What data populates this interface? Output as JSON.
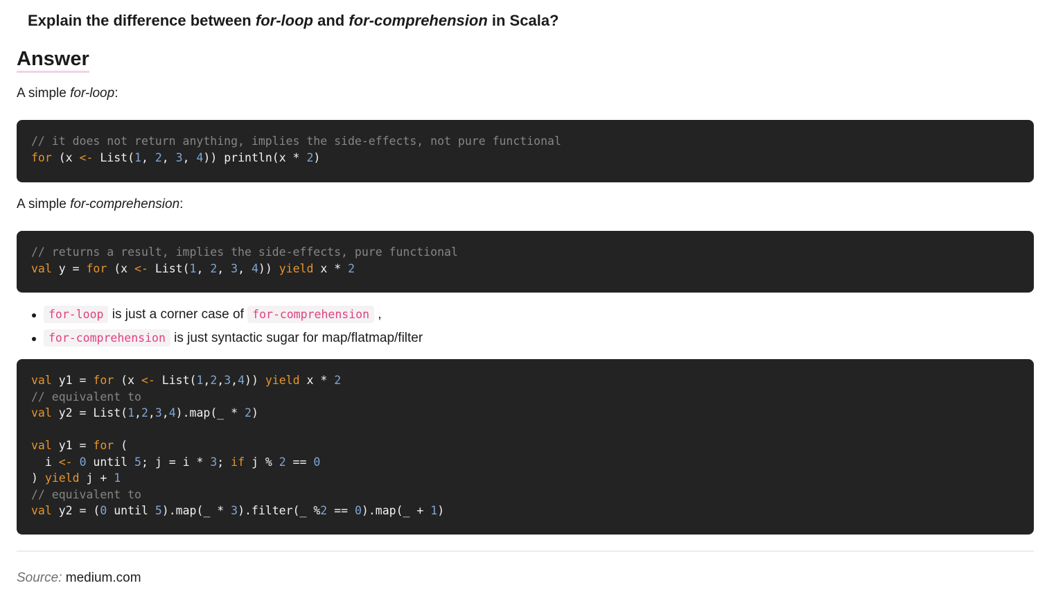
{
  "question": {
    "prefix": "Explain the difference between ",
    "term1": "for-loop",
    "middle": " and ",
    "term2": "for-comprehension",
    "suffix": " in Scala?"
  },
  "answer_heading": "Answer",
  "section1": {
    "prefix": "A simple ",
    "term": "for-loop",
    "suffix": ":"
  },
  "code1": [
    [
      {
        "t": "// it does not return anything, implies the side-effects, not pure functional",
        "c": "cmt"
      }
    ],
    [
      {
        "t": "for",
        "c": "kw"
      },
      {
        "t": " (x "
      },
      {
        "t": "<-",
        "c": "kw"
      },
      {
        "t": " List("
      },
      {
        "t": "1",
        "c": "num"
      },
      {
        "t": ", "
      },
      {
        "t": "2",
        "c": "num"
      },
      {
        "t": ", "
      },
      {
        "t": "3",
        "c": "num"
      },
      {
        "t": ", "
      },
      {
        "t": "4",
        "c": "num"
      },
      {
        "t": ")) println(x * "
      },
      {
        "t": "2",
        "c": "num"
      },
      {
        "t": ")"
      }
    ]
  ],
  "section2": {
    "prefix": "A simple ",
    "term": "for-comprehension",
    "suffix": ":"
  },
  "code2": [
    [
      {
        "t": "// returns a result, implies the side-effects, pure functional",
        "c": "cmt"
      }
    ],
    [
      {
        "t": "val",
        "c": "kw"
      },
      {
        "t": " y = "
      },
      {
        "t": "for",
        "c": "kw"
      },
      {
        "t": " (x "
      },
      {
        "t": "<-",
        "c": "kw"
      },
      {
        "t": " List("
      },
      {
        "t": "1",
        "c": "num"
      },
      {
        "t": ", "
      },
      {
        "t": "2",
        "c": "num"
      },
      {
        "t": ", "
      },
      {
        "t": "3",
        "c": "num"
      },
      {
        "t": ", "
      },
      {
        "t": "4",
        "c": "num"
      },
      {
        "t": ")) "
      },
      {
        "t": "yield",
        "c": "kw"
      },
      {
        "t": " x * "
      },
      {
        "t": "2",
        "c": "num"
      }
    ]
  ],
  "bullets": [
    {
      "code1": "for-loop",
      "text1": " is just a corner case of ",
      "code2": "for-comprehension",
      "text2": " ,"
    },
    {
      "code1": "for-comprehension",
      "text1": " is just syntactic sugar for map/flatmap/filter",
      "code2": "",
      "text2": ""
    }
  ],
  "code3": [
    [
      {
        "t": "val",
        "c": "kw"
      },
      {
        "t": " y1 = "
      },
      {
        "t": "for",
        "c": "kw"
      },
      {
        "t": " (x "
      },
      {
        "t": "<-",
        "c": "kw"
      },
      {
        "t": " List("
      },
      {
        "t": "1",
        "c": "num"
      },
      {
        "t": ","
      },
      {
        "t": "2",
        "c": "num"
      },
      {
        "t": ","
      },
      {
        "t": "3",
        "c": "num"
      },
      {
        "t": ","
      },
      {
        "t": "4",
        "c": "num"
      },
      {
        "t": ")) "
      },
      {
        "t": "yield",
        "c": "kw"
      },
      {
        "t": " x * "
      },
      {
        "t": "2",
        "c": "num"
      }
    ],
    [
      {
        "t": "// equivalent to",
        "c": "cmt"
      }
    ],
    [
      {
        "t": "val",
        "c": "kw"
      },
      {
        "t": " y2 = List("
      },
      {
        "t": "1",
        "c": "num"
      },
      {
        "t": ","
      },
      {
        "t": "2",
        "c": "num"
      },
      {
        "t": ","
      },
      {
        "t": "3",
        "c": "num"
      },
      {
        "t": ","
      },
      {
        "t": "4",
        "c": "num"
      },
      {
        "t": ").map(_ * "
      },
      {
        "t": "2",
        "c": "num"
      },
      {
        "t": ")"
      }
    ],
    [],
    [
      {
        "t": "val",
        "c": "kw"
      },
      {
        "t": " y1 = "
      },
      {
        "t": "for",
        "c": "kw"
      },
      {
        "t": " ("
      }
    ],
    [
      {
        "t": "  i "
      },
      {
        "t": "<-",
        "c": "kw"
      },
      {
        "t": " "
      },
      {
        "t": "0",
        "c": "num"
      },
      {
        "t": " until "
      },
      {
        "t": "5",
        "c": "num"
      },
      {
        "t": "; j = i * "
      },
      {
        "t": "3",
        "c": "num"
      },
      {
        "t": "; "
      },
      {
        "t": "if",
        "c": "kw"
      },
      {
        "t": " j % "
      },
      {
        "t": "2",
        "c": "num"
      },
      {
        "t": " == "
      },
      {
        "t": "0",
        "c": "num"
      }
    ],
    [
      {
        "t": ") "
      },
      {
        "t": "yield",
        "c": "kw"
      },
      {
        "t": " j + "
      },
      {
        "t": "1",
        "c": "num"
      }
    ],
    [
      {
        "t": "// equivalent to",
        "c": "cmt"
      }
    ],
    [
      {
        "t": "val",
        "c": "kw"
      },
      {
        "t": " y2 = ("
      },
      {
        "t": "0",
        "c": "num"
      },
      {
        "t": " until "
      },
      {
        "t": "5",
        "c": "num"
      },
      {
        "t": ").map(_ * "
      },
      {
        "t": "3",
        "c": "num"
      },
      {
        "t": ").filter(_ %"
      },
      {
        "t": "2",
        "c": "num"
      },
      {
        "t": " == "
      },
      {
        "t": "0",
        "c": "num"
      },
      {
        "t": ").map(_ + "
      },
      {
        "t": "1",
        "c": "num"
      },
      {
        "t": ")"
      }
    ]
  ],
  "source": {
    "label": "Source:",
    "value": "medium.com"
  },
  "colors": {
    "code_bg": "#232323",
    "keyword": "#e6952d",
    "number": "#7fa6d6",
    "comment": "#868686",
    "inline_code": "#e0407f",
    "heading_underline": "#f3d2e4"
  }
}
